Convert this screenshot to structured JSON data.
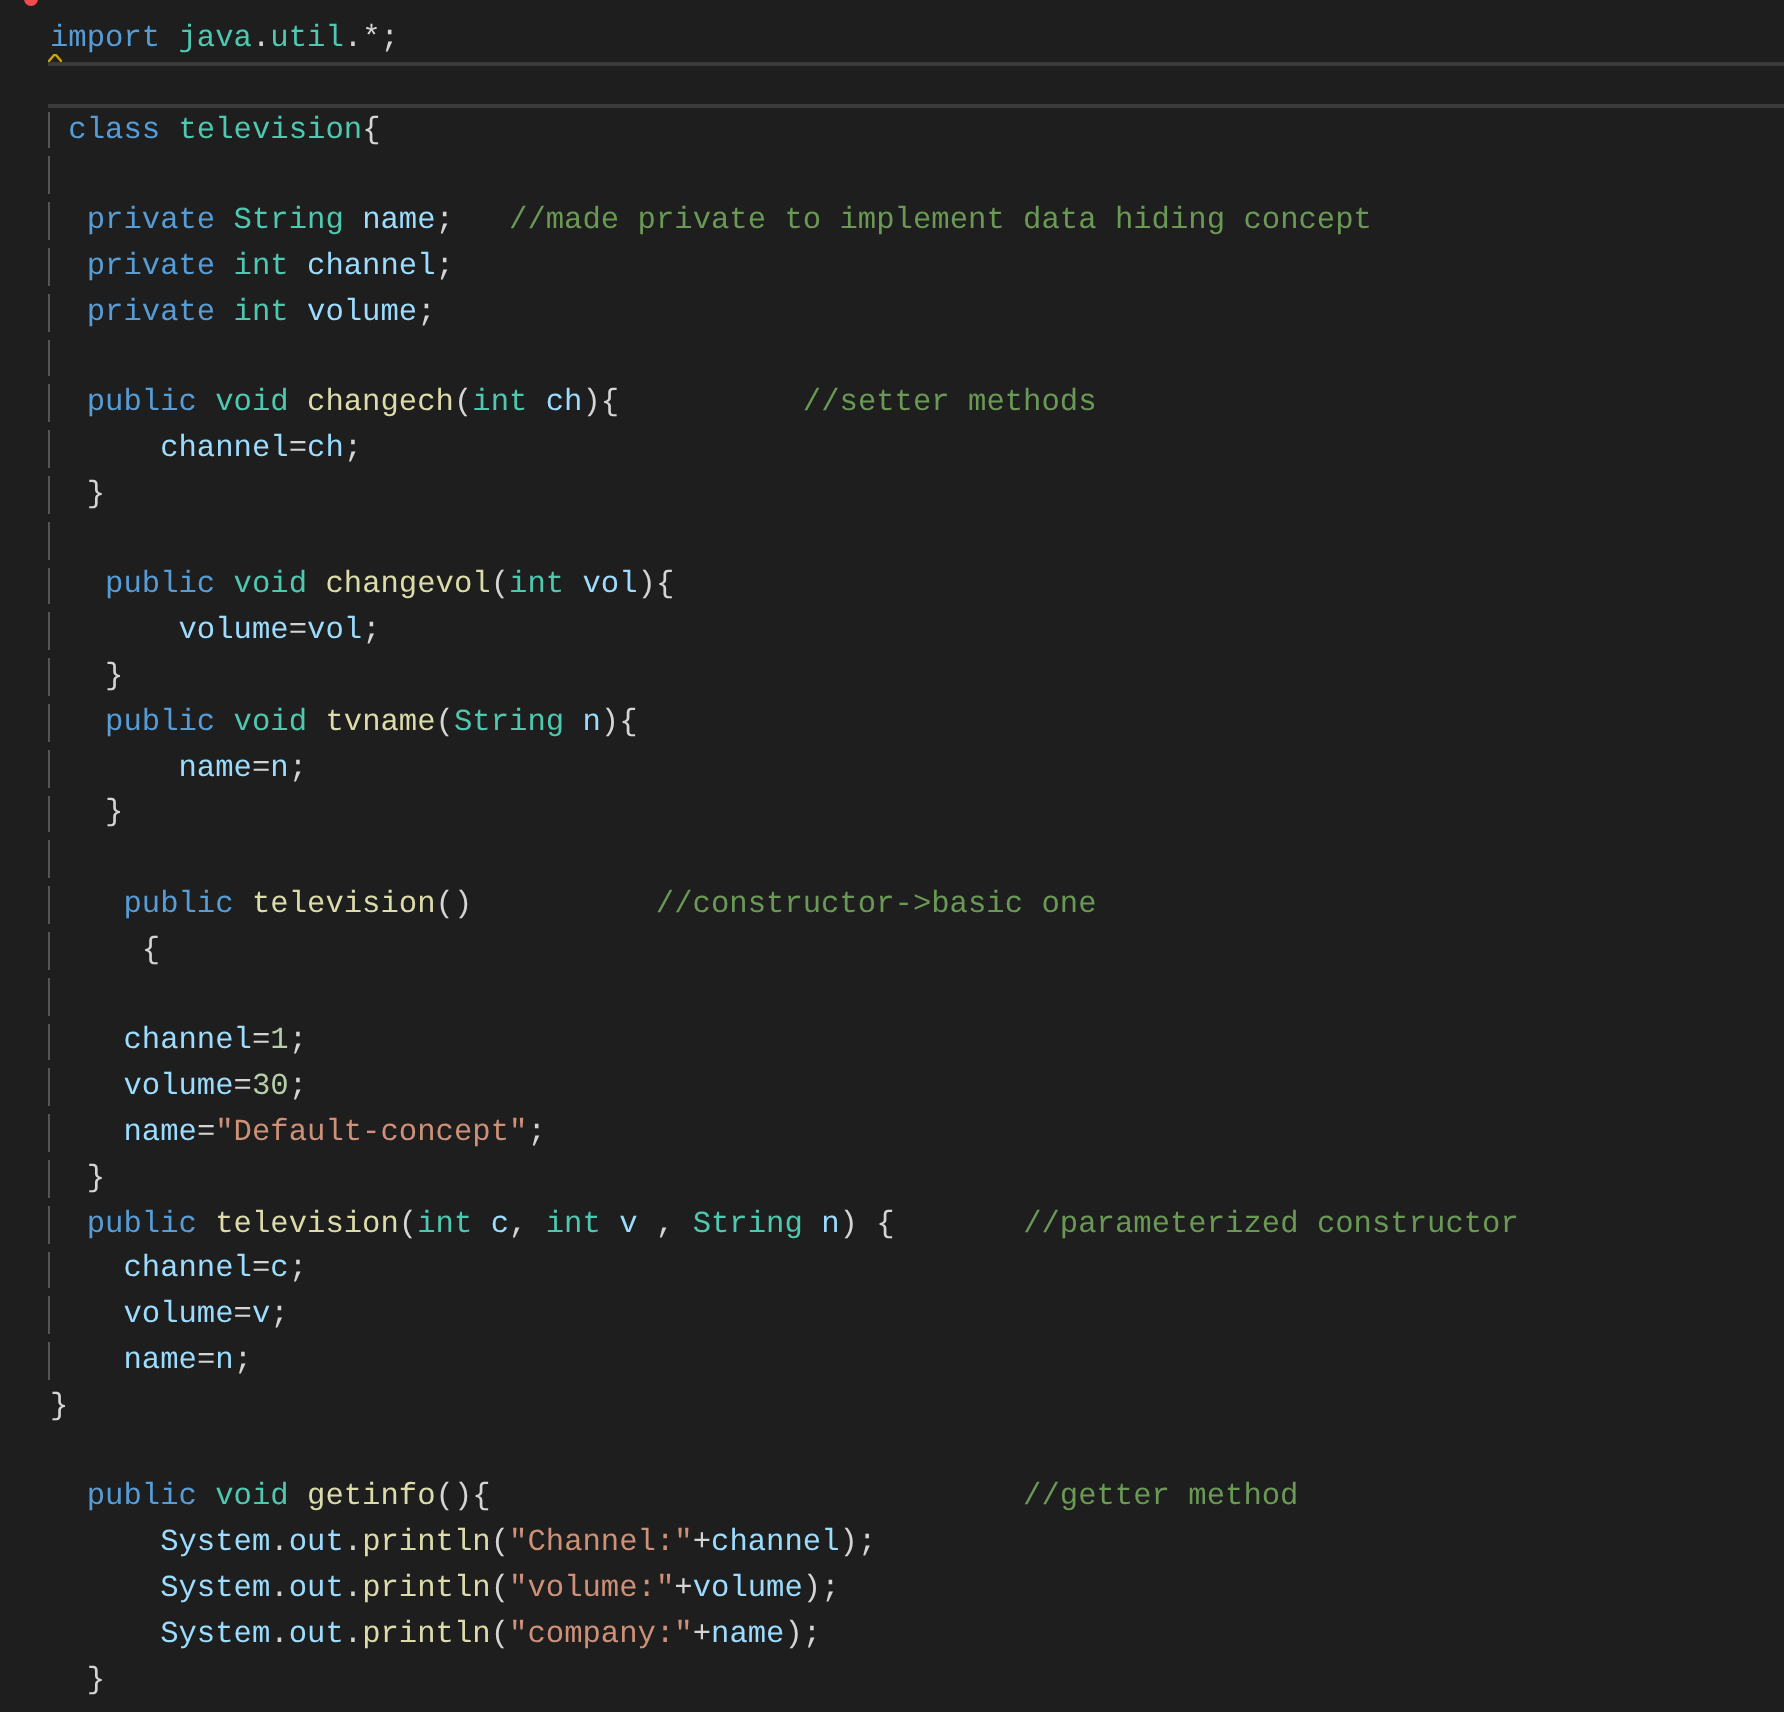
{
  "editor": {
    "lines": [
      {
        "kind": "code",
        "current": false,
        "tokens": [
          {
            "kind": "keyword",
            "text": "import"
          },
          {
            "kind": "type",
            "text": " java"
          },
          {
            "kind": "plain",
            "text": "."
          },
          {
            "kind": "type",
            "text": "util"
          },
          {
            "kind": "plain",
            "text": ".*;"
          }
        ]
      },
      {
        "kind": "blank",
        "current": true
      },
      {
        "kind": "code",
        "current": false,
        "tokens": [
          {
            "kind": "keyword",
            "text": " class"
          },
          {
            "kind": "type",
            "text": " television"
          },
          {
            "kind": "plain",
            "text": "{"
          }
        ]
      },
      {
        "kind": "blank",
        "current": false
      },
      {
        "kind": "code",
        "current": false,
        "tokens": [
          {
            "kind": "keyword",
            "text": "  private"
          },
          {
            "kind": "type",
            "text": " String"
          },
          {
            "kind": "variable",
            "text": " name"
          },
          {
            "kind": "plain",
            "text": ";"
          },
          {
            "kind": "comment",
            "text": "   //made private to implement data hiding concept"
          }
        ]
      },
      {
        "kind": "code",
        "current": false,
        "tokens": [
          {
            "kind": "keyword",
            "text": "  private"
          },
          {
            "kind": "type",
            "text": " int"
          },
          {
            "kind": "variable",
            "text": " channel"
          },
          {
            "kind": "plain",
            "text": ";"
          }
        ]
      },
      {
        "kind": "code",
        "current": false,
        "tokens": [
          {
            "kind": "keyword",
            "text": "  private"
          },
          {
            "kind": "type",
            "text": " int"
          },
          {
            "kind": "variable",
            "text": " volume"
          },
          {
            "kind": "plain",
            "text": ";"
          }
        ]
      },
      {
        "kind": "blank",
        "current": false
      },
      {
        "kind": "code",
        "current": false,
        "tokens": [
          {
            "kind": "keyword",
            "text": "  public"
          },
          {
            "kind": "type",
            "text": " void"
          },
          {
            "kind": "function",
            "text": " changech"
          },
          {
            "kind": "plain",
            "text": "("
          },
          {
            "kind": "type",
            "text": "int"
          },
          {
            "kind": "variable",
            "text": " ch"
          },
          {
            "kind": "plain",
            "text": "){"
          },
          {
            "kind": "comment",
            "text": "          //setter methods"
          }
        ]
      },
      {
        "kind": "code",
        "current": false,
        "tokens": [
          {
            "kind": "variable",
            "text": "      channel"
          },
          {
            "kind": "plain",
            "text": "="
          },
          {
            "kind": "variable",
            "text": "ch"
          },
          {
            "kind": "plain",
            "text": ";"
          }
        ]
      },
      {
        "kind": "code",
        "current": false,
        "tokens": [
          {
            "kind": "plain",
            "text": "  }"
          }
        ]
      },
      {
        "kind": "blank",
        "current": false
      },
      {
        "kind": "code",
        "current": false,
        "tokens": [
          {
            "kind": "keyword",
            "text": "   public"
          },
          {
            "kind": "type",
            "text": " void"
          },
          {
            "kind": "function",
            "text": " changevol"
          },
          {
            "kind": "plain",
            "text": "("
          },
          {
            "kind": "type",
            "text": "int"
          },
          {
            "kind": "variable",
            "text": " vol"
          },
          {
            "kind": "plain",
            "text": "){"
          }
        ]
      },
      {
        "kind": "code",
        "current": false,
        "tokens": [
          {
            "kind": "variable",
            "text": "       volume"
          },
          {
            "kind": "plain",
            "text": "="
          },
          {
            "kind": "variable",
            "text": "vol"
          },
          {
            "kind": "plain",
            "text": ";"
          }
        ]
      },
      {
        "kind": "code",
        "current": false,
        "tokens": [
          {
            "kind": "plain",
            "text": "   }"
          }
        ]
      },
      {
        "kind": "code",
        "current": false,
        "tokens": [
          {
            "kind": "keyword",
            "text": "   public"
          },
          {
            "kind": "type",
            "text": " void"
          },
          {
            "kind": "function",
            "text": " tvname"
          },
          {
            "kind": "plain",
            "text": "("
          },
          {
            "kind": "type",
            "text": "String"
          },
          {
            "kind": "variable",
            "text": " n"
          },
          {
            "kind": "plain",
            "text": "){"
          }
        ]
      },
      {
        "kind": "code",
        "current": false,
        "tokens": [
          {
            "kind": "variable",
            "text": "       name"
          },
          {
            "kind": "plain",
            "text": "="
          },
          {
            "kind": "variable",
            "text": "n"
          },
          {
            "kind": "plain",
            "text": ";"
          }
        ]
      },
      {
        "kind": "code",
        "current": false,
        "tokens": [
          {
            "kind": "plain",
            "text": "   }"
          }
        ]
      },
      {
        "kind": "blank",
        "current": false
      },
      {
        "kind": "code",
        "current": false,
        "tokens": [
          {
            "kind": "keyword",
            "text": "    public"
          },
          {
            "kind": "function",
            "text": " television"
          },
          {
            "kind": "plain",
            "text": "()"
          },
          {
            "kind": "comment",
            "text": "          //constructor->basic one"
          }
        ]
      },
      {
        "kind": "code",
        "current": false,
        "tokens": [
          {
            "kind": "plain",
            "text": "     {"
          }
        ]
      },
      {
        "kind": "blank",
        "current": false
      },
      {
        "kind": "code",
        "current": false,
        "tokens": [
          {
            "kind": "variable",
            "text": "    channel"
          },
          {
            "kind": "plain",
            "text": "="
          },
          {
            "kind": "number",
            "text": "1"
          },
          {
            "kind": "plain",
            "text": ";"
          }
        ]
      },
      {
        "kind": "code",
        "current": false,
        "tokens": [
          {
            "kind": "variable",
            "text": "    volume"
          },
          {
            "kind": "plain",
            "text": "="
          },
          {
            "kind": "number",
            "text": "30"
          },
          {
            "kind": "plain",
            "text": ";"
          }
        ]
      },
      {
        "kind": "code",
        "current": false,
        "tokens": [
          {
            "kind": "variable",
            "text": "    name"
          },
          {
            "kind": "plain",
            "text": "="
          },
          {
            "kind": "string",
            "text": "\"Default-concept\""
          },
          {
            "kind": "plain",
            "text": ";"
          }
        ]
      },
      {
        "kind": "code",
        "current": false,
        "tokens": [
          {
            "kind": "plain",
            "text": "  }"
          }
        ]
      },
      {
        "kind": "code",
        "current": false,
        "tokens": [
          {
            "kind": "keyword",
            "text": "  public"
          },
          {
            "kind": "function",
            "text": " television"
          },
          {
            "kind": "plain",
            "text": "("
          },
          {
            "kind": "type",
            "text": "int"
          },
          {
            "kind": "variable",
            "text": " c"
          },
          {
            "kind": "plain",
            "text": ", "
          },
          {
            "kind": "type",
            "text": "int"
          },
          {
            "kind": "variable",
            "text": " v"
          },
          {
            "kind": "plain",
            "text": " , "
          },
          {
            "kind": "type",
            "text": "String"
          },
          {
            "kind": "variable",
            "text": " n"
          },
          {
            "kind": "plain",
            "text": ") {"
          },
          {
            "kind": "comment",
            "text": "       //parameterized constructor"
          }
        ]
      },
      {
        "kind": "code",
        "current": false,
        "tokens": [
          {
            "kind": "variable",
            "text": "    channel"
          },
          {
            "kind": "plain",
            "text": "="
          },
          {
            "kind": "variable",
            "text": "c"
          },
          {
            "kind": "plain",
            "text": ";"
          }
        ]
      },
      {
        "kind": "code",
        "current": false,
        "tokens": [
          {
            "kind": "variable",
            "text": "    volume"
          },
          {
            "kind": "plain",
            "text": "="
          },
          {
            "kind": "variable",
            "text": "v"
          },
          {
            "kind": "plain",
            "text": ";"
          }
        ]
      },
      {
        "kind": "code",
        "current": false,
        "tokens": [
          {
            "kind": "variable",
            "text": "    name"
          },
          {
            "kind": "plain",
            "text": "="
          },
          {
            "kind": "variable",
            "text": "n"
          },
          {
            "kind": "plain",
            "text": ";"
          }
        ]
      },
      {
        "kind": "code",
        "current": false,
        "tokens": [
          {
            "kind": "plain",
            "text": "}"
          }
        ]
      },
      {
        "kind": "blank",
        "current": false
      },
      {
        "kind": "code",
        "current": false,
        "tokens": [
          {
            "kind": "keyword",
            "text": "  public"
          },
          {
            "kind": "type",
            "text": " void"
          },
          {
            "kind": "function",
            "text": " getinfo"
          },
          {
            "kind": "plain",
            "text": "(){"
          },
          {
            "kind": "comment",
            "text": "                             //getter method"
          }
        ]
      },
      {
        "kind": "code",
        "current": false,
        "tokens": [
          {
            "kind": "variable",
            "text": "      System"
          },
          {
            "kind": "plain",
            "text": "."
          },
          {
            "kind": "variable",
            "text": "out"
          },
          {
            "kind": "plain",
            "text": "."
          },
          {
            "kind": "function",
            "text": "println"
          },
          {
            "kind": "plain",
            "text": "("
          },
          {
            "kind": "string",
            "text": "\"Channel:\""
          },
          {
            "kind": "plain",
            "text": "+"
          },
          {
            "kind": "variable",
            "text": "channel"
          },
          {
            "kind": "plain",
            "text": ");"
          }
        ]
      },
      {
        "kind": "code",
        "current": false,
        "tokens": [
          {
            "kind": "variable",
            "text": "      System"
          },
          {
            "kind": "plain",
            "text": "."
          },
          {
            "kind": "variable",
            "text": "out"
          },
          {
            "kind": "plain",
            "text": "."
          },
          {
            "kind": "function",
            "text": "println"
          },
          {
            "kind": "plain",
            "text": "("
          },
          {
            "kind": "string",
            "text": "\"volume:\""
          },
          {
            "kind": "plain",
            "text": "+"
          },
          {
            "kind": "variable",
            "text": "volume"
          },
          {
            "kind": "plain",
            "text": ");"
          }
        ]
      },
      {
        "kind": "code",
        "current": false,
        "tokens": [
          {
            "kind": "variable",
            "text": "      System"
          },
          {
            "kind": "plain",
            "text": "."
          },
          {
            "kind": "variable",
            "text": "out"
          },
          {
            "kind": "plain",
            "text": "."
          },
          {
            "kind": "function",
            "text": "println"
          },
          {
            "kind": "plain",
            "text": "("
          },
          {
            "kind": "string",
            "text": "\"company:\""
          },
          {
            "kind": "plain",
            "text": "+"
          },
          {
            "kind": "variable",
            "text": "name"
          },
          {
            "kind": "plain",
            "text": ");"
          }
        ]
      },
      {
        "kind": "code",
        "current": false,
        "tokens": [
          {
            "kind": "plain",
            "text": "  }"
          }
        ]
      }
    ]
  }
}
